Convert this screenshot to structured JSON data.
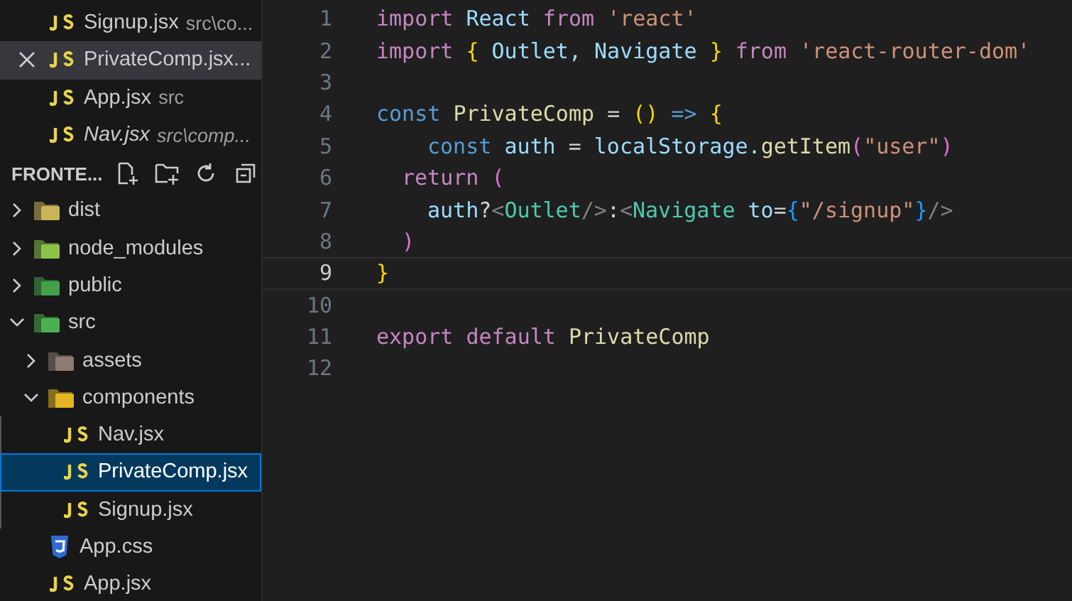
{
  "open_editors": [
    {
      "name": "Signup.jsx",
      "path": "src\\co...",
      "kind": "js",
      "selected": false,
      "preview": false
    },
    {
      "name": "PrivateComp.jsx...",
      "kind": "js",
      "selected": true,
      "preview": false
    },
    {
      "name": "App.jsx",
      "path": "src",
      "kind": "js",
      "selected": false,
      "preview": false
    },
    {
      "name": "Nav.jsx",
      "path": "src\\comp...",
      "kind": "js",
      "selected": false,
      "preview": true
    }
  ],
  "explorer": {
    "title": "FRONTE...",
    "tree": [
      {
        "name": "dist",
        "kind": "folder",
        "color": "#c9b458",
        "expanded": false,
        "selected": false
      },
      {
        "name": "node_modules",
        "kind": "folder",
        "color": "#8bc34a",
        "expanded": false,
        "selected": false
      },
      {
        "name": "public",
        "kind": "folder",
        "color": "#43a047",
        "expanded": false,
        "selected": false
      },
      {
        "name": "src",
        "kind": "folder",
        "color": "#4caf50",
        "expanded": true,
        "selected": false,
        "children": [
          {
            "name": "assets",
            "kind": "folder",
            "color": "#8d7b74",
            "expanded": false,
            "selected": false
          },
          {
            "name": "components",
            "kind": "folder",
            "color": "#e6b422",
            "expanded": true,
            "selected": false,
            "children": [
              {
                "name": "Nav.jsx",
                "kind": "js",
                "selected": false
              },
              {
                "name": "PrivateComp.jsx",
                "kind": "js",
                "selected": true
              },
              {
                "name": "Signup.jsx",
                "kind": "js",
                "selected": false
              }
            ]
          },
          {
            "name": "App.css",
            "kind": "css",
            "selected": false
          },
          {
            "name": "App.jsx",
            "kind": "js",
            "selected": false
          }
        ]
      }
    ]
  },
  "editor": {
    "lines": [
      {
        "number": "1",
        "current": false,
        "kind": "top",
        "tokens": [
          {
            "text": "import ",
            "kind": "keyword"
          },
          {
            "text": "React ",
            "kind": "variable"
          },
          {
            "text": "from ",
            "kind": "keyword"
          },
          {
            "text": "'react'",
            "kind": "string"
          }
        ]
      },
      {
        "number": "2",
        "current": false,
        "kind": "top",
        "tokens": [
          {
            "text": "import ",
            "kind": "keyword"
          },
          {
            "text": "{ ",
            "kind": "bracket1"
          },
          {
            "text": "Outlet, Navigate ",
            "kind": "variable"
          },
          {
            "text": "} ",
            "kind": "bracket1"
          },
          {
            "text": "from ",
            "kind": "keyword"
          },
          {
            "text": "'react-router-dom'",
            "kind": "string"
          }
        ]
      },
      {
        "number": "3",
        "current": false
      },
      {
        "number": "4",
        "current": false,
        "kind": "top",
        "tokens": [
          {
            "text": "const ",
            "kind": "storage"
          },
          {
            "text": "PrivateComp ",
            "kind": "function"
          },
          {
            "text": "= ",
            "kind": "plain"
          },
          {
            "text": "() ",
            "kind": "bracket1"
          },
          {
            "text": "=> ",
            "kind": "storage"
          },
          {
            "text": "{",
            "kind": "bracket1"
          }
        ]
      },
      {
        "number": "5",
        "current": false,
        "kind": "nested",
        "tokens": [
          {
            "text": "const ",
            "kind": "storage"
          },
          {
            "text": "auth ",
            "kind": "variable"
          },
          {
            "text": "= ",
            "kind": "plain"
          },
          {
            "text": "localStorage.",
            "kind": "variable"
          },
          {
            "text": "getItem",
            "kind": "function"
          },
          {
            "text": "(",
            "kind": "bracket2"
          },
          {
            "text": "\"user\"",
            "kind": "string"
          },
          {
            "text": ")",
            "kind": "bracket2"
          }
        ]
      },
      {
        "number": "6",
        "current": false,
        "kind": "inner",
        "tokens": [
          {
            "text": "return ",
            "kind": "keyword"
          },
          {
            "text": "(",
            "kind": "bracket2"
          }
        ]
      },
      {
        "number": "7",
        "current": false,
        "kind": "nested",
        "tokens": [
          {
            "text": "auth",
            "kind": "variable"
          },
          {
            "text": "?",
            "kind": "plain"
          },
          {
            "text": "<",
            "kind": "punct"
          },
          {
            "text": "Outlet",
            "kind": "tag"
          },
          {
            "text": "/>",
            "kind": "punct"
          },
          {
            "text": ":",
            "kind": "plain"
          },
          {
            "text": "<",
            "kind": "punct"
          },
          {
            "text": "Navigate ",
            "kind": "tag"
          },
          {
            "text": "to",
            "kind": "variable"
          },
          {
            "text": "=",
            "kind": "plain"
          },
          {
            "text": "{",
            "kind": "bracket3"
          },
          {
            "text": "\"/signup\"",
            "kind": "string"
          },
          {
            "text": "}",
            "kind": "bracket3"
          },
          {
            "text": "/>",
            "kind": "punct"
          }
        ]
      },
      {
        "number": "8",
        "current": false,
        "kind": "inner",
        "tokens": [
          {
            "text": ")",
            "kind": "bracket2"
          }
        ]
      },
      {
        "number": "9",
        "current": true,
        "kind": "top",
        "tokens": [
          {
            "text": "}",
            "kind": "bracket1"
          }
        ]
      },
      {
        "number": "10",
        "current": false
      },
      {
        "number": "11",
        "current": false,
        "kind": "top",
        "tokens": [
          {
            "text": "export ",
            "kind": "keyword"
          },
          {
            "text": "default ",
            "kind": "keyword"
          },
          {
            "text": "PrivateComp",
            "kind": "function"
          }
        ]
      },
      {
        "number": "12",
        "current": false
      }
    ]
  }
}
